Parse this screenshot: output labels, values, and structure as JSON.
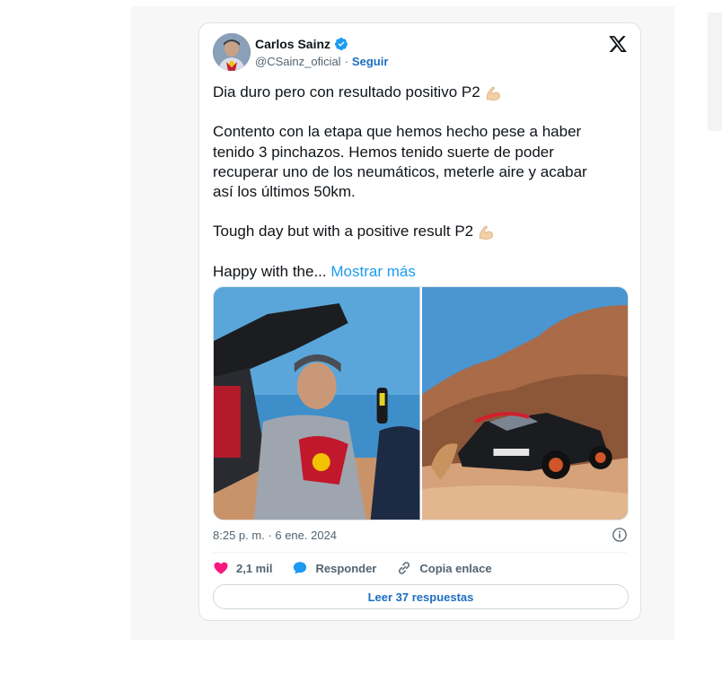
{
  "author": {
    "name": "Carlos Sainz",
    "handle": "@CSainz_oficial",
    "separator": "·",
    "follow_label": "Seguir"
  },
  "tweet": {
    "line1": "Dia duro pero con resultado positivo P2",
    "paragraph2": "Contento con la etapa que hemos hecho pese a haber tenido 3 pinchazos. Hemos tenido suerte de poder recuperar uno de los neumáticos, meterle aire y acabar así los últimos 50km.",
    "line3": "Tough day but with a positive result P2",
    "truncated": "Happy with the...",
    "show_more": "Mostrar más",
    "emoji": "flexed-biceps"
  },
  "timestamp": "8:25 p. m. · 6 ene. 2024",
  "actions": {
    "likes": "2,1 mil",
    "reply": "Responder",
    "copy_link": "Copia enlace"
  },
  "read_replies": "Leer 37 respuestas",
  "icons": [
    "verified-badge-icon",
    "x-logo-icon",
    "info-icon",
    "heart-icon",
    "reply-bubble-icon",
    "link-icon"
  ],
  "colors": {
    "accent": "#1d9bf0",
    "follow": "#1d6fc2",
    "heart": "#f91880",
    "muted": "#536471"
  }
}
